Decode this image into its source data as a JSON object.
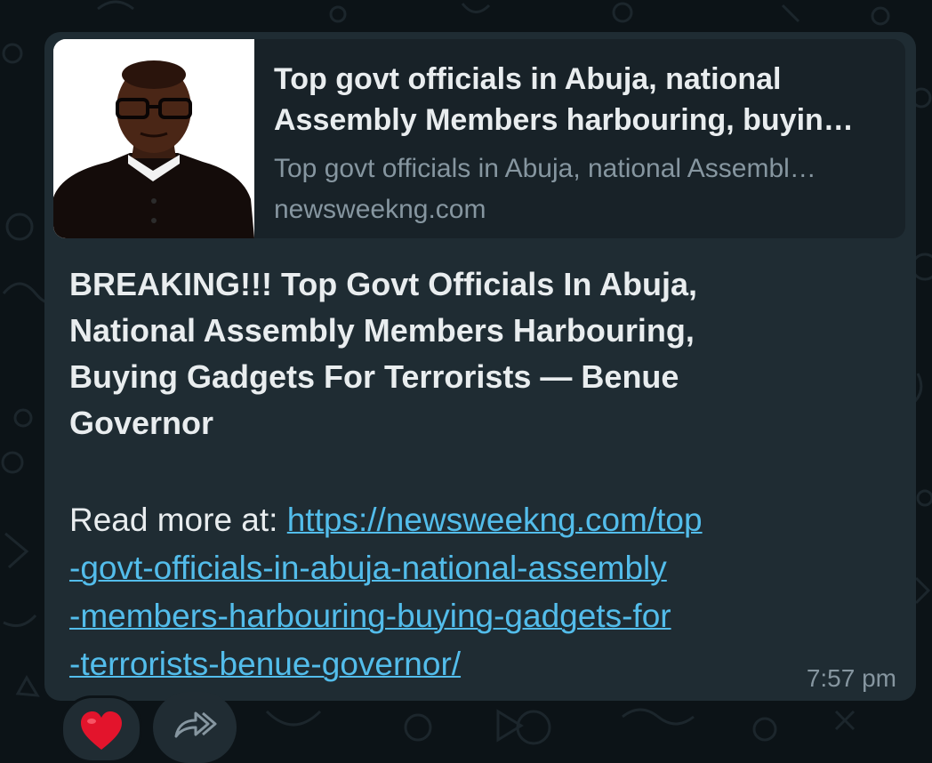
{
  "link_preview": {
    "title": [
      "Top govt officials in Abuja, national",
      "Assembly Members harbouring, buyin…"
    ],
    "description": "Top govt officials in Abuja, national Assembl…",
    "domain": "newsweekng.com",
    "thumbnail_icon": "priest-portrait-image"
  },
  "message": {
    "headline": [
      "BREAKING!!! Top Govt Officials In Abuja,",
      "National Assembly Members Harbouring,",
      "Buying Gadgets For Terrorists — Benue",
      "Governor"
    ],
    "read_more_prefix": "Read more at: ",
    "link_lines": [
      "https://newsweekng.com/top",
      "-govt-officials-in-abuja-national-assembly",
      "-members-harbouring-buying-gadgets-for",
      "-terrorists-benue-governor/"
    ],
    "timestamp": "7:57 pm"
  },
  "reactions": {
    "reaction_icon": "red-heart-icon",
    "forward_icon": "forward-arrow-icon"
  },
  "colors": {
    "background": "#0c1317",
    "bubble": "#1f2c33",
    "preview": "#182228",
    "link": "#53bdeb",
    "text": "#e9edef",
    "secondary_text": "#8696a0"
  }
}
